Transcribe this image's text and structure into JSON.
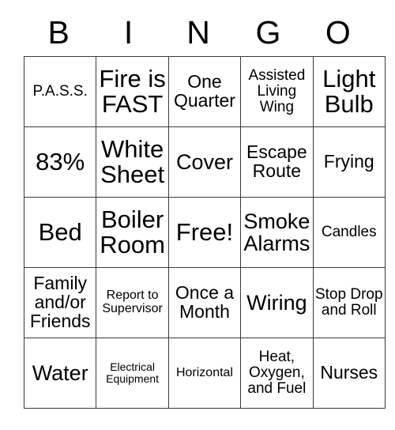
{
  "header": {
    "letters": [
      "B",
      "I",
      "N",
      "G",
      "O"
    ]
  },
  "grid": {
    "rows": [
      [
        {
          "text": "P.A.S.S.",
          "size": "sz-sm"
        },
        {
          "text": "Fire is FAST",
          "size": "sz-xl"
        },
        {
          "text": "One Quarter",
          "size": "sz-md"
        },
        {
          "text": "Assisted Living Wing",
          "size": "sz-sm"
        },
        {
          "text": "Light Bulb",
          "size": "sz-xl"
        }
      ],
      [
        {
          "text": "83%",
          "size": "sz-xl"
        },
        {
          "text": "White Sheet",
          "size": "sz-xl"
        },
        {
          "text": "Cover",
          "size": "sz-lg"
        },
        {
          "text": "Escape Route",
          "size": "sz-md"
        },
        {
          "text": "Frying",
          "size": "sz-md"
        }
      ],
      [
        {
          "text": "Bed",
          "size": "sz-xl"
        },
        {
          "text": "Boiler Room",
          "size": "sz-xl"
        },
        {
          "text": "Free!",
          "size": "sz-xl"
        },
        {
          "text": "Smoke Alarms",
          "size": "sz-lg"
        },
        {
          "text": "Candles",
          "size": "sz-sm"
        }
      ],
      [
        {
          "text": "Family and/or Friends",
          "size": "sz-md"
        },
        {
          "text": "Report to Supervisor",
          "size": "sz-xs"
        },
        {
          "text": "Once a Month",
          "size": "sz-md"
        },
        {
          "text": "Wiring",
          "size": "sz-lg"
        },
        {
          "text": "Stop Drop and Roll",
          "size": "sz-sm"
        }
      ],
      [
        {
          "text": "Water",
          "size": "sz-lg"
        },
        {
          "text": "Electrical Equipment",
          "size": "sz-xxs"
        },
        {
          "text": "Horizontal",
          "size": "sz-xs"
        },
        {
          "text": "Heat, Oxygen, and Fuel",
          "size": "sz-sm"
        },
        {
          "text": "Nurses",
          "size": "sz-md"
        }
      ]
    ]
  }
}
